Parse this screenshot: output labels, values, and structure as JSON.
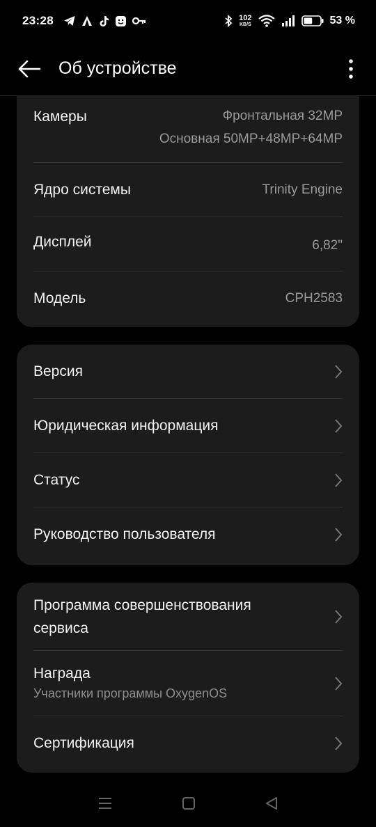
{
  "status_bar": {
    "time": "23:28",
    "left_icons": [
      "telegram-icon",
      "tent-icon",
      "tiktok-icon",
      "face-icon",
      "key-icon"
    ],
    "net_speed_value": "102",
    "net_speed_unit": "KB/S",
    "battery_percent": "53 %",
    "battery_level": 53
  },
  "app_bar": {
    "title": "Об устройстве"
  },
  "specs": {
    "cameras_label": "Камеры",
    "cameras_front": "Фронтальная 32MP",
    "cameras_main": "Основная 50MP+48MP+64MP",
    "kernel_label": "Ядро системы",
    "kernel_value": "Trinity Engine",
    "display_label": "Дисплей",
    "display_value": "6,82\"",
    "model_label": "Модель",
    "model_value": "CPH2583"
  },
  "info_menu": {
    "version": "Версия",
    "legal": "Юридическая информация",
    "status": "Статус",
    "manual": "Руководство пользователя"
  },
  "program_menu": {
    "improvement_line1": "Программа совершенствования",
    "improvement_line2": "сервиса",
    "reward": "Награда",
    "reward_sub": "Участники программы OxygenOS",
    "certification": "Сертификация"
  },
  "colors": {
    "background": "#000000",
    "card": "#1c1c1c",
    "divider": "#333333",
    "secondary_text": "#9a9a9a"
  }
}
